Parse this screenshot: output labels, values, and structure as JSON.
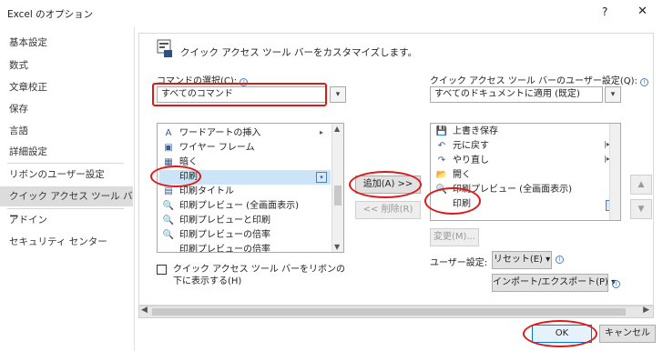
{
  "window": {
    "title": "Excel のオプション",
    "help": "?",
    "close": "✕"
  },
  "sidebar": {
    "items": [
      {
        "label": "基本設定"
      },
      {
        "label": "数式"
      },
      {
        "label": "文章校正"
      },
      {
        "label": "保存"
      },
      {
        "label": "言語"
      },
      {
        "label": "詳細設定"
      },
      {
        "label": "リボンのユーザー設定"
      },
      {
        "label": "クイック アクセス ツール バー",
        "selected": true
      },
      {
        "label": "アドイン"
      },
      {
        "label": "セキュリティ センター"
      }
    ]
  },
  "header": {
    "text": "クイック アクセス ツール バーをカスタマイズします。"
  },
  "left": {
    "choose_label": "コマンドの選択(C):",
    "choose_value": "すべてのコマンド",
    "commands": [
      {
        "label": "ワードアートの挿入",
        "icon": "A",
        "arrow": "▸"
      },
      {
        "label": "ワイヤー フレーム",
        "icon": "▣"
      },
      {
        "label": "暗く",
        "icon": "▦"
      },
      {
        "label": "印刷",
        "icon": "",
        "selected": true
      },
      {
        "label": "印刷タイトル",
        "icon": "▤"
      },
      {
        "label": "印刷プレビュー (全画面表示)",
        "icon": "🔍"
      },
      {
        "label": "印刷プレビューと印刷",
        "icon": "🔍"
      },
      {
        "label": "印刷プレビューの倍率",
        "icon": "🔍"
      },
      {
        "label": "印刷プレビューの倍率",
        "icon": ""
      }
    ],
    "below_ribbon_label": "クイック アクセス ツール バーをリボンの下に表示する(H)"
  },
  "middle": {
    "add_button": "追加(A) >>",
    "remove_button": "<< 削除(R)"
  },
  "right": {
    "customize_label": "クイック アクセス ツール バーのユーザー設定(Q):",
    "customize_value": "すべてのドキュメントに適用 (既定)",
    "items": [
      {
        "label": "上書き保存",
        "icon": "💾"
      },
      {
        "label": "元に戻す",
        "icon": "↶",
        "arrow": "|▸"
      },
      {
        "label": "やり直し",
        "icon": "↷",
        "arrow": "|▸"
      },
      {
        "label": "開く",
        "icon": "📂"
      },
      {
        "label": "印刷プレビュー (全画面表示)",
        "icon": "🔍"
      },
      {
        "label": "印刷",
        "icon": ""
      }
    ],
    "modify_button": "変更(M)...",
    "user_settings_label": "ユーザー設定:",
    "reset_button": "リセット(E) ▾",
    "import_export_button": "インポート/エクスポート(P) ▾"
  },
  "footer": {
    "ok": "OK",
    "cancel": "キャンセル"
  }
}
